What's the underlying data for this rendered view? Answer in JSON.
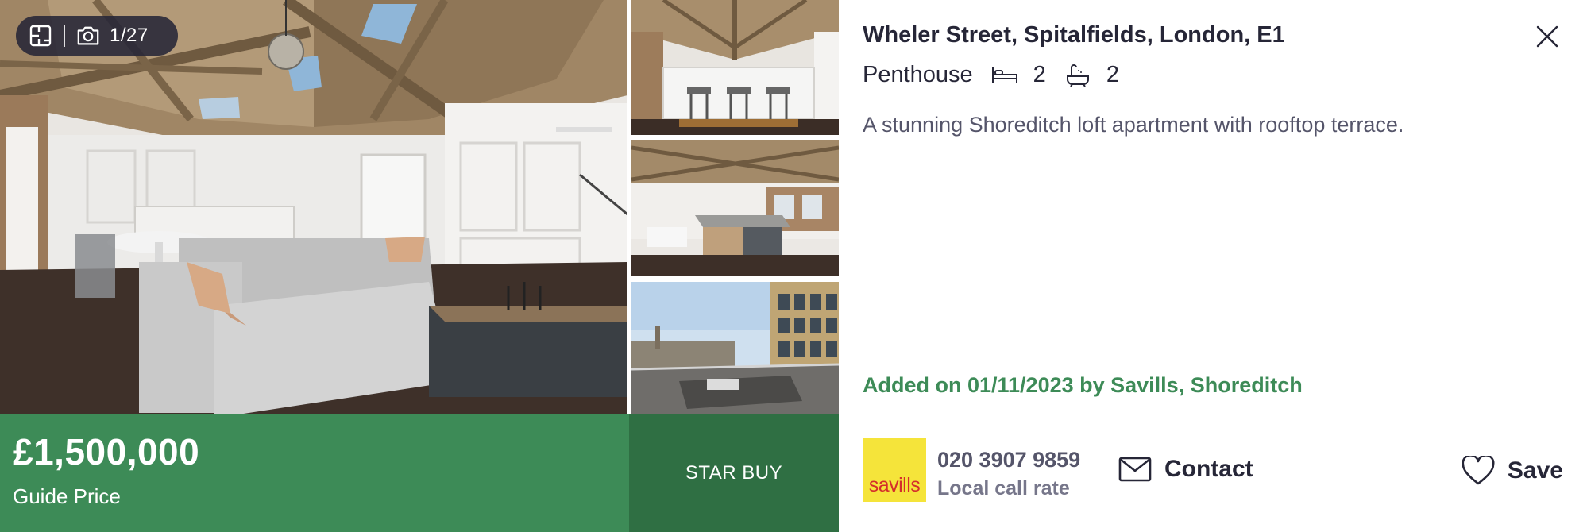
{
  "gallery": {
    "photo_counter": "1/27",
    "icons": [
      "floorplan-icon",
      "camera-icon"
    ]
  },
  "listing": {
    "price": "£1,500,000",
    "price_qualifier": "Guide Price",
    "badge": "STAR BUY",
    "address": "Wheler Street, Spitalfields, London, E1",
    "property_type": "Penthouse",
    "bedrooms": "2",
    "bathrooms": "2",
    "description": "A stunning Shoreditch loft apartment with rooftop terrace.",
    "added": "Added on 01/11/2023 by Savills, Shoreditch"
  },
  "agent": {
    "logo_text": "savills",
    "phone": "020 3907 9859",
    "phone_note": "Local call rate"
  },
  "actions": {
    "contact_label": "Contact",
    "save_label": "Save"
  },
  "colors": {
    "brand_green": "#3d8b57",
    "badge_green": "#2f6f43",
    "text_dark": "#262637",
    "text_muted": "#55556a",
    "savills_yellow": "#f5e43a",
    "savills_red": "#d42e2b"
  }
}
